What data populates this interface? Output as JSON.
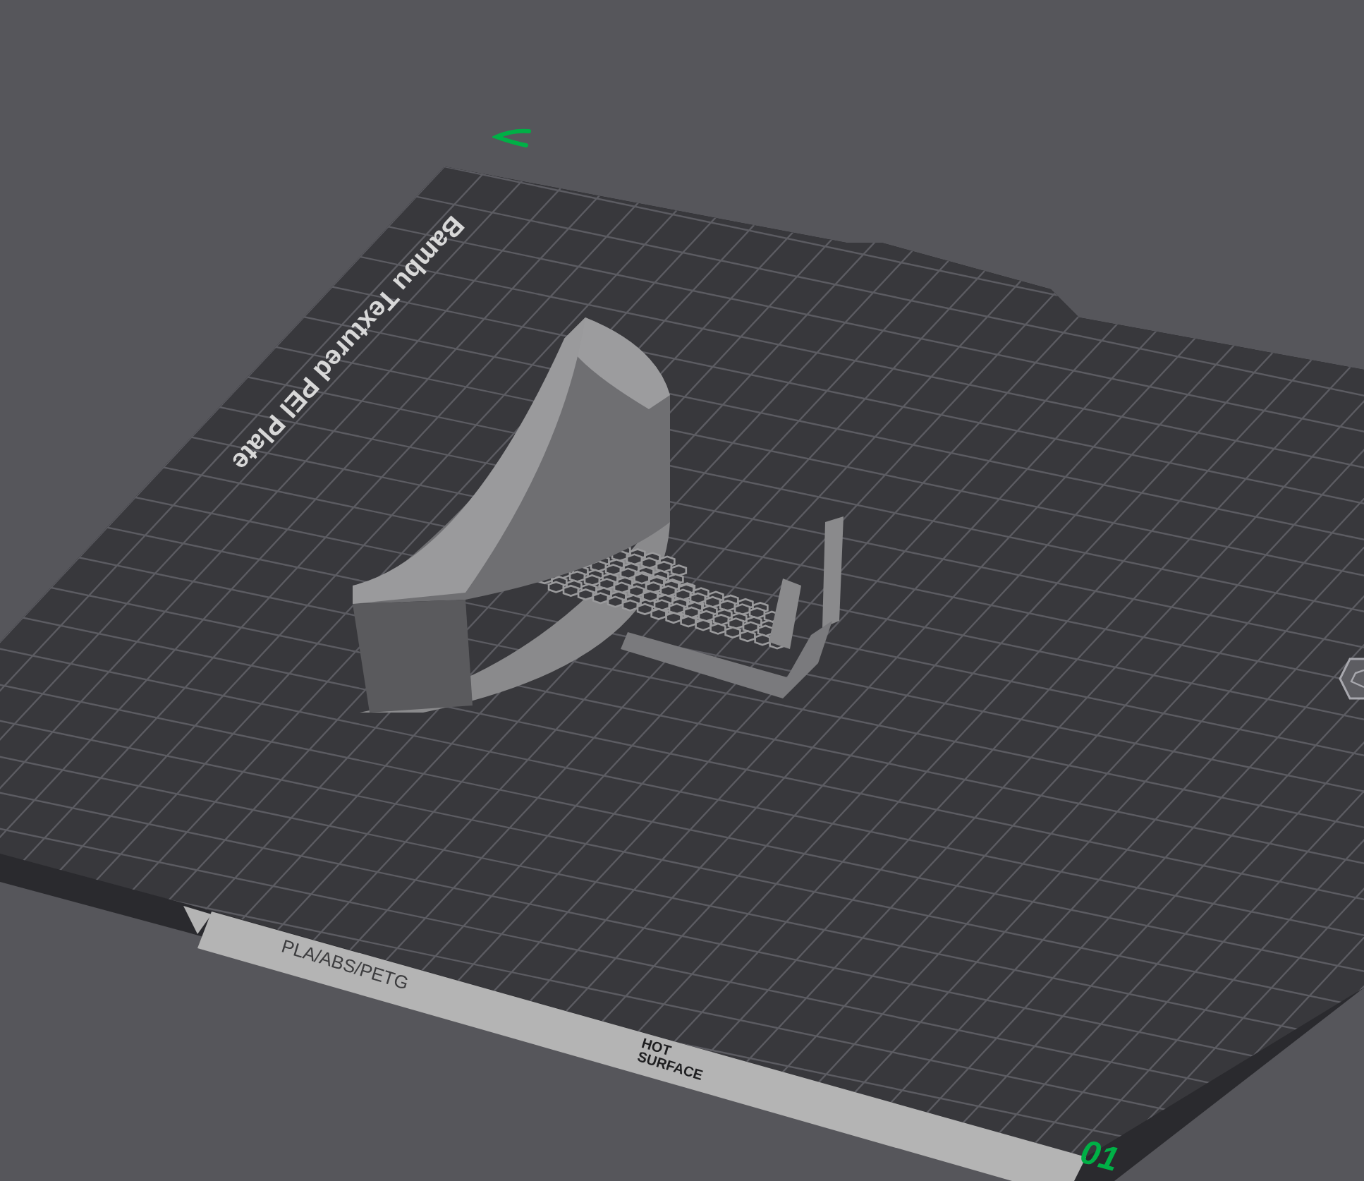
{
  "viewport": {
    "plate": {
      "name": "Bambu Textured PEI Plate",
      "material_label": "PLA/ABS/PETG",
      "warning_label": "HOT SURFACE",
      "plate_number": "01"
    }
  }
}
